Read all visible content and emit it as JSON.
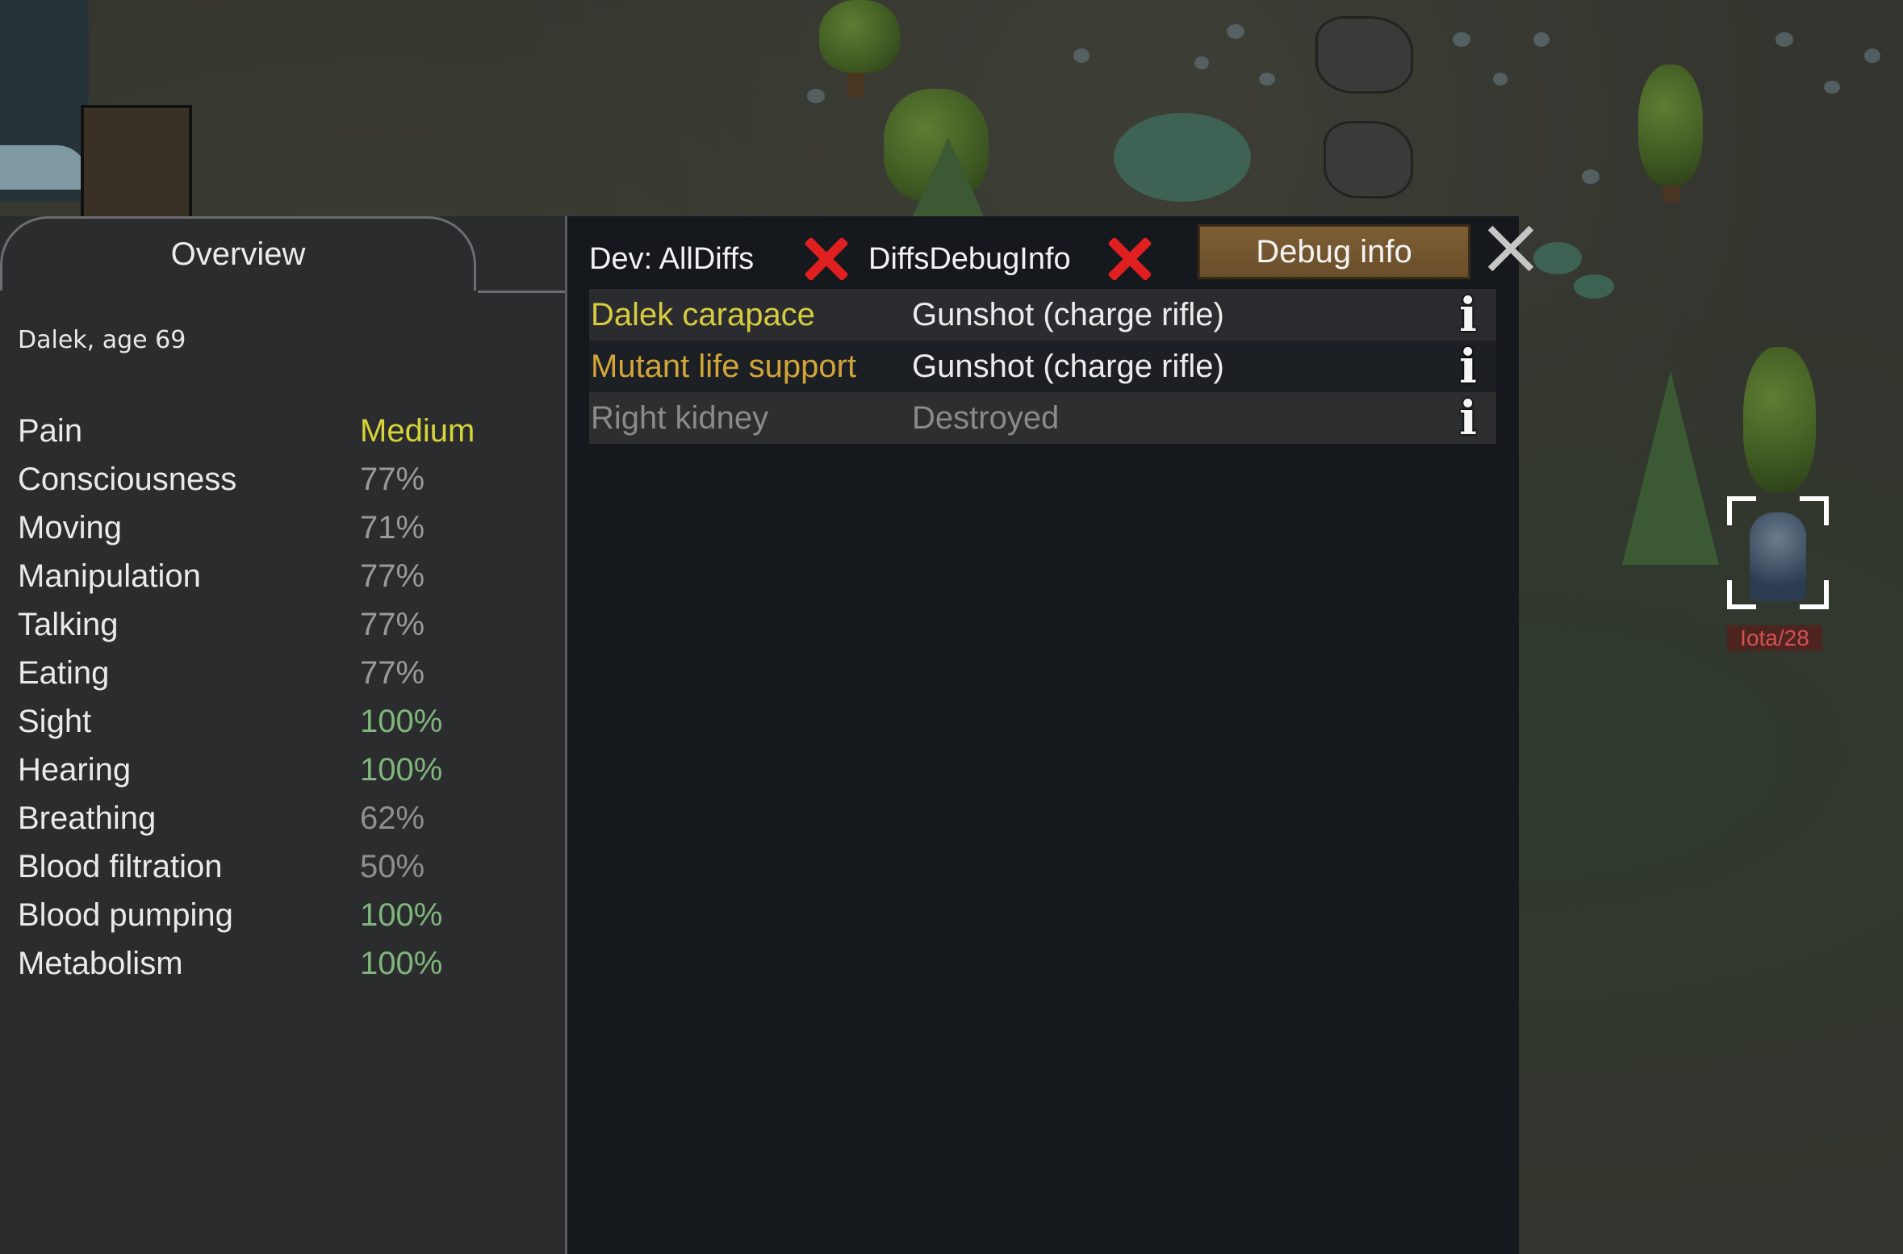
{
  "map": {
    "pawn_label": "Iota/28"
  },
  "health_tab": {
    "tab_title": "Overview",
    "pawn_summary": "Dalek, age 69",
    "capacities": [
      {
        "name": "Pain",
        "value": "Medium",
        "color": "#d6d43a"
      },
      {
        "name": "Consciousness",
        "value": "77%",
        "color": "#9a9a9a"
      },
      {
        "name": "Moving",
        "value": "71%",
        "color": "#9a9a9a"
      },
      {
        "name": "Manipulation",
        "value": "77%",
        "color": "#9a9a9a"
      },
      {
        "name": "Talking",
        "value": "77%",
        "color": "#9a9a9a"
      },
      {
        "name": "Eating",
        "value": "77%",
        "color": "#9a9a9a"
      },
      {
        "name": "Sight",
        "value": "100%",
        "color": "#80b57c"
      },
      {
        "name": "Hearing",
        "value": "100%",
        "color": "#80b57c"
      },
      {
        "name": "Breathing",
        "value": "62%",
        "color": "#8f8f8f"
      },
      {
        "name": "Blood filtration",
        "value": "50%",
        "color": "#8f8f8f"
      },
      {
        "name": "Blood pumping",
        "value": "100%",
        "color": "#80b57c"
      },
      {
        "name": "Metabolism",
        "value": "100%",
        "color": "#80b57c"
      }
    ]
  },
  "toolbar": {
    "dev_all_diffs": "Dev: AllDiffs",
    "diffs_debug_info": "DiffsDebugInfo",
    "debug_info_button": "Debug info"
  },
  "hediffs": [
    {
      "part": "Dalek carapace",
      "effect": "Gunshot (charge rifle)",
      "part_color": "#d9cb3f",
      "effect_color": "#ececec",
      "row": "odd"
    },
    {
      "part": "Mutant life support",
      "effect": "Gunshot (charge rifle)",
      "part_color": "#d2a53a",
      "effect_color": "#ececec",
      "row": "even"
    },
    {
      "part": "Right kidney",
      "effect": "Destroyed",
      "part_color": "#8a8a8a",
      "effect_color": "#8a8a8a",
      "row": "destroyed"
    }
  ]
}
